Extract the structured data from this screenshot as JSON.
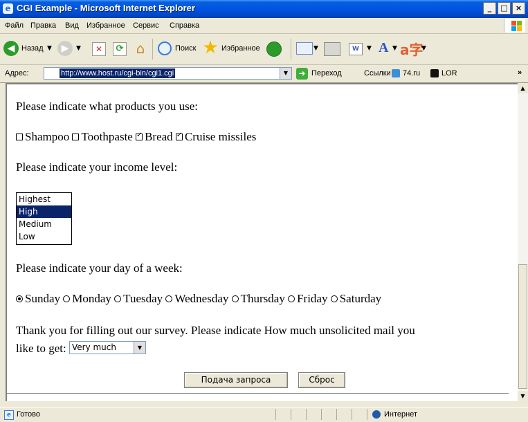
{
  "window": {
    "title": "CGI Example - Microsoft Internet Explorer"
  },
  "menu": {
    "items": [
      "Файл",
      "Правка",
      "Вид",
      "Избранное",
      "Сервис",
      "Справка"
    ]
  },
  "toolbar": {
    "back_label": "Назад",
    "search_label": "Поиск",
    "favorites_label": "Избранное"
  },
  "address": {
    "label": "Адрес:",
    "url": "http://www.host.ru/cgi-bin/cgi1.cgi",
    "go_label": "Переход",
    "links_label": "Ссылки",
    "link1": "74.ru",
    "link2": "LOR"
  },
  "form": {
    "q_products": "Please indicate what products you use:",
    "products": [
      {
        "label": "Shampoo",
        "checked": false
      },
      {
        "label": "Toothpaste",
        "checked": false
      },
      {
        "label": "Bread",
        "checked": true
      },
      {
        "label": "Cruise missiles",
        "checked": true
      }
    ],
    "q_income": "Please indicate your income level:",
    "income_options": [
      "Highest",
      "High",
      "Medium",
      "Low"
    ],
    "income_selected": "High",
    "q_day": "Please indicate your day of a week:",
    "days": [
      "Sunday",
      "Monday",
      "Tuesday",
      "Wednesday",
      "Thursday",
      "Friday",
      "Saturday"
    ],
    "day_selected": "Sunday",
    "q_mail_line1": "Thank you for filling out our survey. Please indicate How much unsolicited mail you",
    "q_mail_line2": "like to get:",
    "mail_value": "Very much",
    "submit_label": "Подача запроса",
    "reset_label": "Сброс"
  },
  "status": {
    "text": "Готово",
    "zone": "Интернет"
  }
}
